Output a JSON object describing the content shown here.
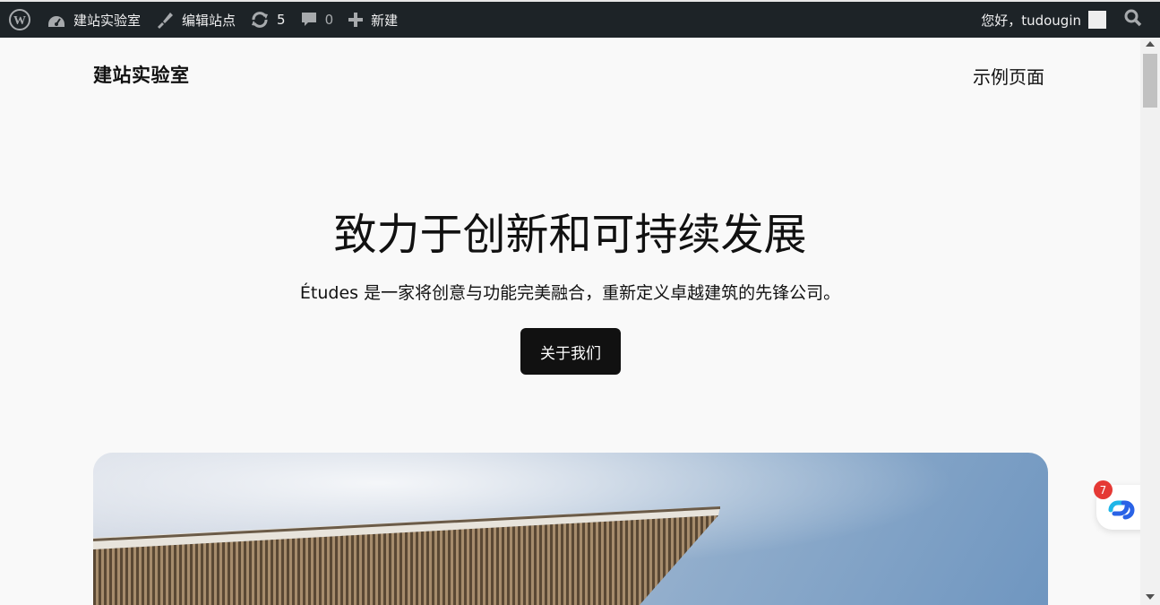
{
  "adminbar": {
    "site_name": "建站实验室",
    "edit_site": "编辑站点",
    "updates_count": "5",
    "comments_count": "0",
    "new_label": "新建",
    "greeting": "您好，tudougin"
  },
  "header": {
    "site_title": "建站实验室",
    "nav_link": "示例页面"
  },
  "hero": {
    "title": "致力于创新和可持续发展",
    "description": "Études 是一家将创意与功能完美融合，重新定义卓越建筑的先锋公司。",
    "button_label": "关于我们"
  },
  "widget": {
    "badge_count": "7"
  },
  "colors": {
    "adminbar_bg": "#1d2327",
    "page_bg": "#f9f9f9",
    "button_bg": "#111111",
    "badge_red": "#e53935"
  }
}
